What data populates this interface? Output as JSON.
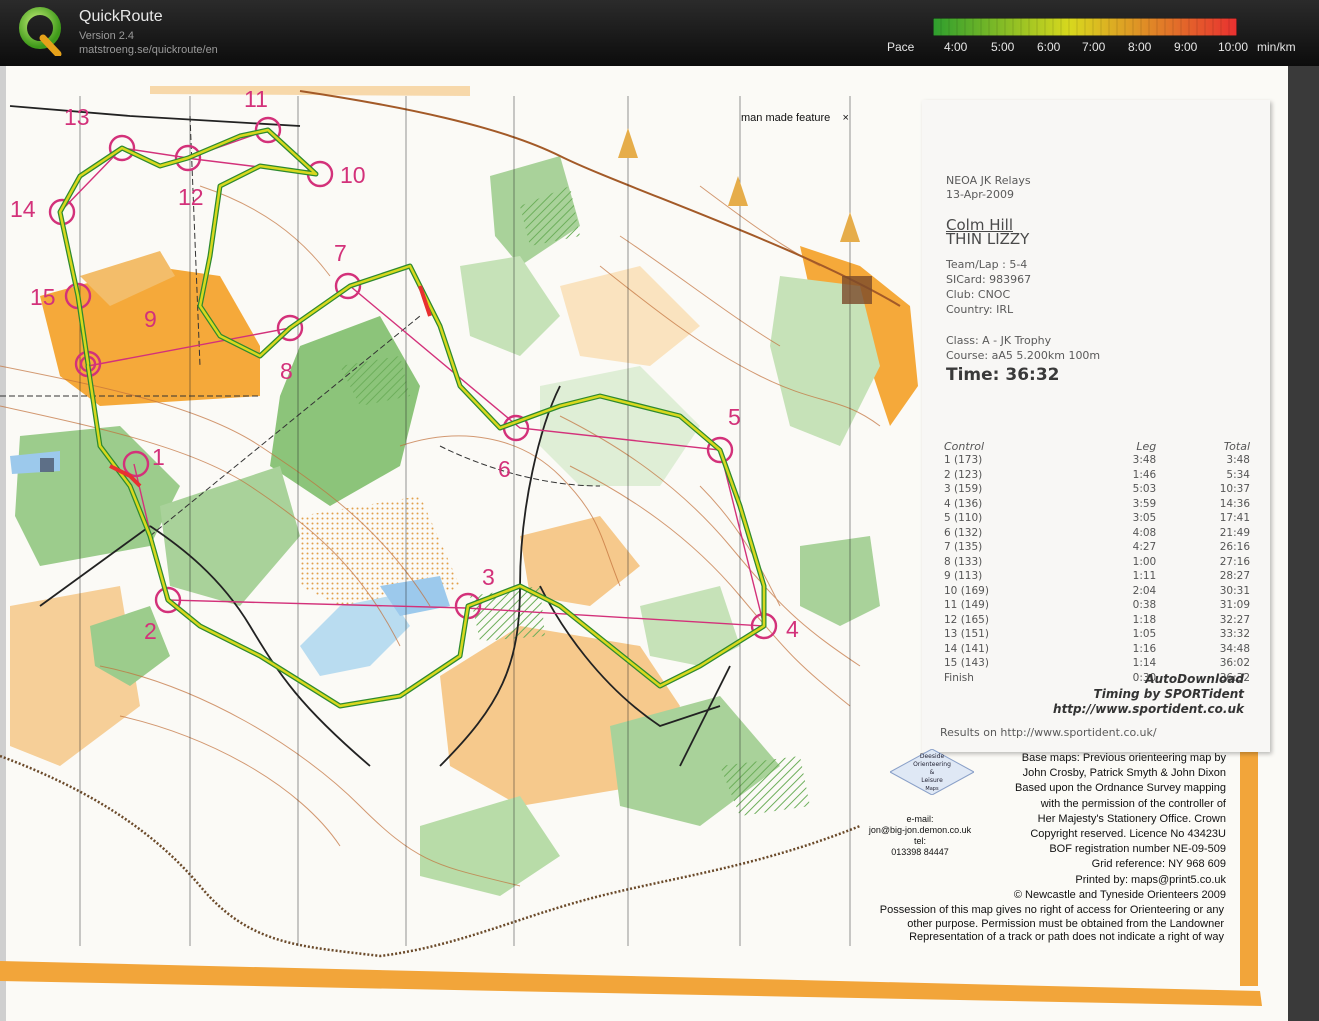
{
  "app": {
    "title": "QuickRoute",
    "version": "Version 2.4",
    "url": "matstroeng.se/quickroute/en"
  },
  "pace": {
    "label": "Pace",
    "ticks": [
      "4:00",
      "5:00",
      "6:00",
      "7:00",
      "8:00",
      "9:00",
      "10:00"
    ],
    "unit": "min/km",
    "colors": {
      "fast": "#2e9e2e",
      "mid": "#d8d81e",
      "slow": "#e83030"
    }
  },
  "map": {
    "route_color": "#d8d81e",
    "course_color": "#d3317a",
    "controls": [
      "1",
      "2",
      "3",
      "4",
      "5",
      "6",
      "7",
      "8",
      "9",
      "10",
      "11",
      "12",
      "13",
      "14",
      "15"
    ],
    "feature_note": "man made feature",
    "feature_symbol": "×",
    "credits": [
      "Base maps: Previous orienteering map by",
      "John Crosby, Patrick Smyth & John Dixon",
      "Based upon the Ordnance Survey mapping",
      "with the permission of the controller of",
      "Her Majesty's Stationery Office. Crown",
      "Copyright reserved. Licence No 43423U",
      "BOF registration number NE-09-509",
      "Grid reference:  NY 968 609",
      "Printed by: maps@print5.co.uk",
      "© Newcastle and Tyneside Orienteers 2009"
    ],
    "possession": [
      "Possession of this map gives no right of access for Orienteering or any",
      "other purpose. Permission must be obtained from the Landowner",
      "Representation of a track or path does not indicate a right of way"
    ],
    "contact": {
      "logo_text": [
        "Deeside",
        "Orienteering",
        "&",
        "Leisure",
        "Maps"
      ],
      "email_label": "e-mail:",
      "email": "jon@big-jon.demon.co.uk",
      "tel_label": "tel:",
      "tel": "013398 84447"
    }
  },
  "receipt": {
    "event": "NEOA JK Relays",
    "date": "13-Apr-2009",
    "name1": "Colm Hill",
    "name2": "THIN LIZZY",
    "team_lap": "Team/Lap  : 5-4",
    "sicard": "SICard: 983967",
    "club": "Club:  CNOC",
    "country": "Country:  IRL",
    "class": "Class:  A - JK Trophy",
    "course": "Course: aA5 5.200km 100m",
    "time": "Time: 36:32",
    "headers": {
      "control": "Control",
      "leg": "Leg",
      "total": "Total"
    },
    "splits": [
      {
        "control": "1 (173)",
        "leg": "3:48",
        "total": "3:48"
      },
      {
        "control": "2 (123)",
        "leg": "1:46",
        "total": "5:34"
      },
      {
        "control": "3 (159)",
        "leg": "5:03",
        "total": "10:37"
      },
      {
        "control": "4 (136)",
        "leg": "3:59",
        "total": "14:36"
      },
      {
        "control": "5 (110)",
        "leg": "3:05",
        "total": "17:41"
      },
      {
        "control": "6 (132)",
        "leg": "4:08",
        "total": "21:49"
      },
      {
        "control": "7 (135)",
        "leg": "4:27",
        "total": "26:16"
      },
      {
        "control": "8 (133)",
        "leg": "1:00",
        "total": "27:16"
      },
      {
        "control": "9 (113)",
        "leg": "1:11",
        "total": "28:27"
      },
      {
        "control": "10 (169)",
        "leg": "2:04",
        "total": "30:31"
      },
      {
        "control": "11 (149)",
        "leg": "0:38",
        "total": "31:09"
      },
      {
        "control": "12 (165)",
        "leg": "1:18",
        "total": "32:27"
      },
      {
        "control": "13 (151)",
        "leg": "1:05",
        "total": "33:32"
      },
      {
        "control": "14 (141)",
        "leg": "1:16",
        "total": "34:48"
      },
      {
        "control": "15 (143)",
        "leg": "1:14",
        "total": "36:02"
      },
      {
        "control": "Finish",
        "leg": "0:30",
        "total": "36:32"
      }
    ],
    "autodownload": "AutoDownload",
    "timing": "Timing by SPORTident",
    "url": "http://www.sportident.co.uk",
    "results": "Results  on  http://www.sportident.co.uk/"
  }
}
